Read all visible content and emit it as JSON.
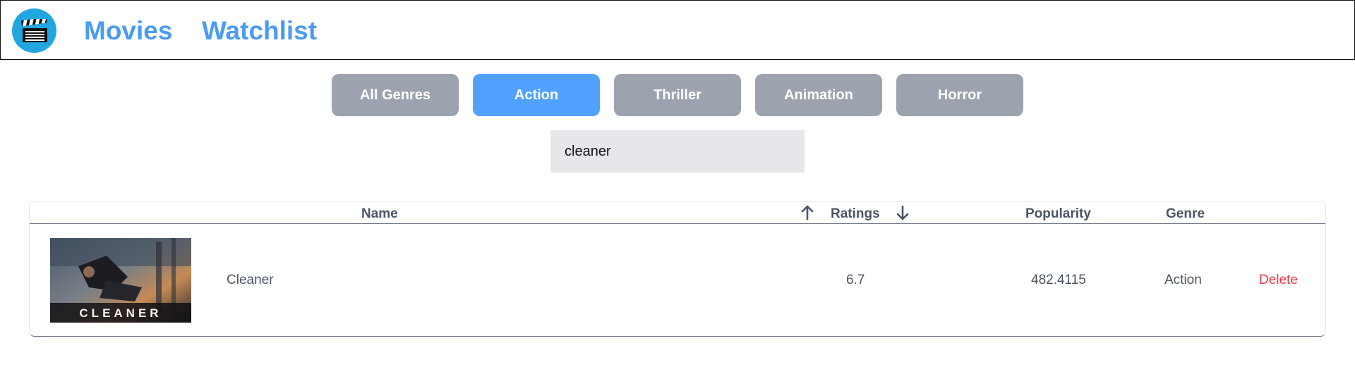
{
  "navbar": {
    "logo_icon": "clapperboard-icon",
    "links": {
      "movies": "Movies",
      "watchlist": "Watchlist"
    },
    "link_color": "#4a9bf2"
  },
  "genres": {
    "items": [
      "All Genres",
      "Action",
      "Thriller",
      "Animation",
      "Horror"
    ],
    "selected": "Action",
    "active_color": "#51a2ff",
    "inactive_color": "#9ca3af"
  },
  "search": {
    "value": "cleaner"
  },
  "table": {
    "headers": {
      "name": "Name",
      "ratings": "Ratings",
      "popularity": "Popularity",
      "genre": "Genre"
    },
    "sort_icons": [
      "arrow-up-icon",
      "arrow-down-icon"
    ],
    "rows": [
      {
        "poster_text": "CLEANER",
        "name": "Cleaner",
        "rating": "6.7",
        "popularity": "482.4115",
        "genre": "Action",
        "action": "Delete"
      }
    ]
  }
}
